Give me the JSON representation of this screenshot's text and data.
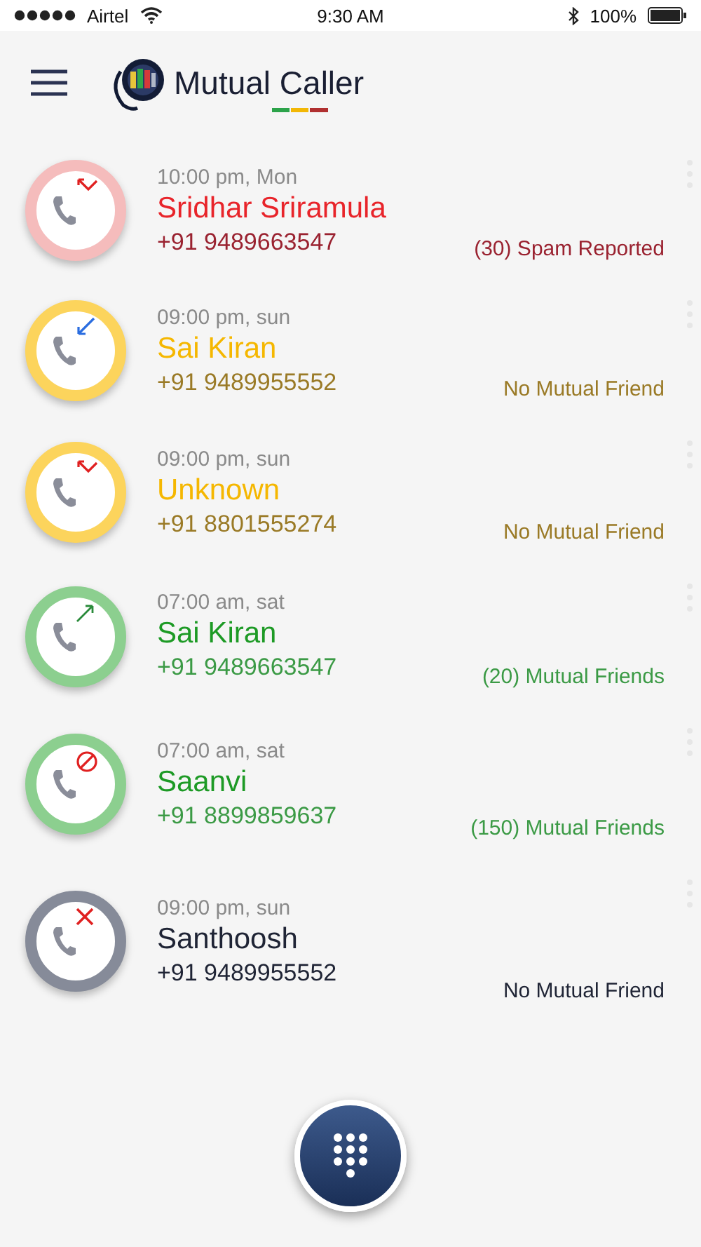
{
  "status_bar": {
    "carrier": "Airtel",
    "time": "9:30 AM",
    "battery": "100%"
  },
  "header": {
    "title": "Mutual Caller"
  },
  "calls": [
    {
      "time": "10:00 pm, Mon",
      "name": "Sridhar Sriramula",
      "number": "+91 9489663547",
      "note": "(30) Spam Reported",
      "color": "#f5bcbc",
      "kind": "missed"
    },
    {
      "time": "09:00 pm, sun",
      "name": "Sai Kiran",
      "number": "+91 9489955552",
      "note": "No Mutual Friend",
      "color": "#fcd45c",
      "kind": "incoming"
    },
    {
      "time": "09:00 pm, sun",
      "name": "Unknown",
      "number": "+91 8801555274",
      "note": "No Mutual Friend",
      "color": "#fcd45c",
      "kind": "missed"
    },
    {
      "time": "07:00 am, sat",
      "name": "Sai Kiran",
      "number": "+91 9489663547",
      "note": "(20) Mutual Friends",
      "color": "#8ccf8f",
      "kind": "outgoing"
    },
    {
      "time": "07:00 am, sat",
      "name": "Saanvi",
      "number": "+91 8899859637",
      "note": "(150) Mutual Friends",
      "color": "#8ccf8f",
      "kind": "blocked"
    },
    {
      "time": "09:00 pm, sun",
      "name": "Santhoosh",
      "number": "+91 9489955552",
      "note": "No Mutual Friend",
      "color": "#868b99",
      "kind": "rejected"
    }
  ]
}
